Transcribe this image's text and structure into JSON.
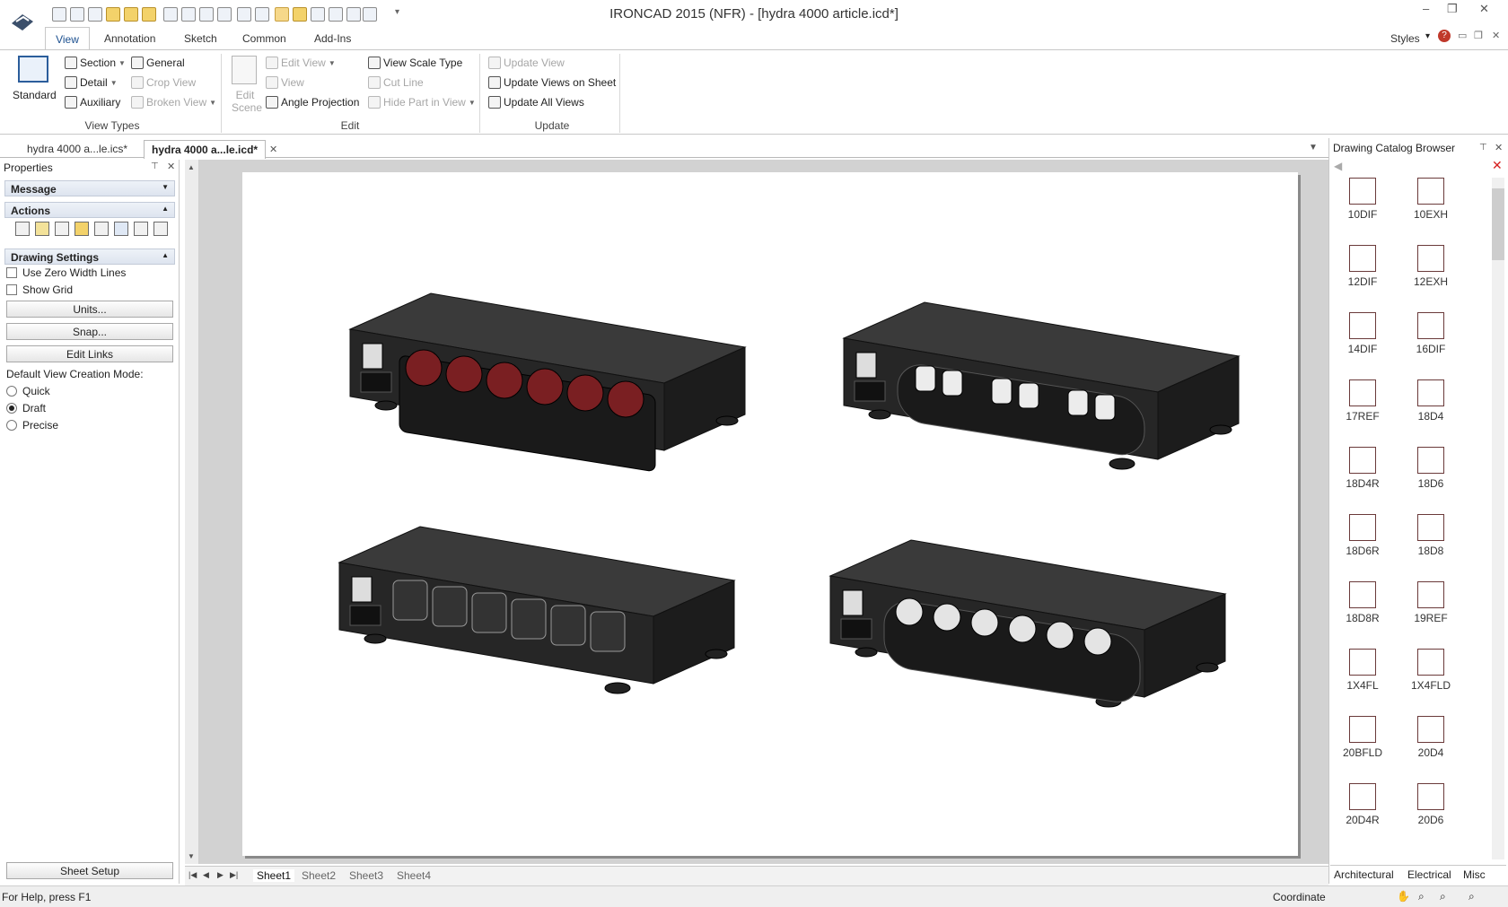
{
  "window": {
    "title": "IRONCAD 2015 (NFR) - [hydra 4000 article.icd*]",
    "styles_label": "Styles"
  },
  "ribbon_tabs": [
    "View",
    "Annotation",
    "Sketch",
    "Common",
    "Add-Ins"
  ],
  "ribbon": {
    "standard": "Standard",
    "section": "Section",
    "detail": "Detail",
    "auxiliary": "Auxiliary",
    "general": "General",
    "crop_view": "Crop View",
    "broken_view": "Broken View",
    "group_view_types": "View Types",
    "edit_scene": "Edit Scene",
    "edit_view": "Edit View",
    "view": "View",
    "angle_projection": "Angle Projection",
    "view_scale_type": "View Scale Type",
    "cut_line": "Cut Line",
    "hide_part_in_view": "Hide Part in View",
    "group_edit": "Edit",
    "update_view": "Update View",
    "update_views_on_sheet": "Update Views on Sheet",
    "update_all_views": "Update All Views",
    "group_update": "Update"
  },
  "doc_tabs": [
    "hydra 4000 a...le.ics*",
    "hydra 4000 a...le.icd*"
  ],
  "properties": {
    "title": "Properties",
    "message": "Message",
    "actions": "Actions",
    "drawing_settings": "Drawing Settings",
    "use_zero_width_lines": "Use Zero Width Lines",
    "show_grid": "Show Grid",
    "units_btn": "Units...",
    "snap_btn": "Snap...",
    "edit_links_btn": "Edit Links",
    "default_view_mode_label": "Default View Creation Mode:",
    "modes": [
      "Quick",
      "Draft",
      "Precise"
    ],
    "selected_mode": "Draft",
    "sheet_setup_btn": "Sheet Setup"
  },
  "sheet_tabs": [
    "Sheet1",
    "Sheet2",
    "Sheet3",
    "Sheet4"
  ],
  "catalog": {
    "title": "Drawing Catalog Browser",
    "items": [
      "10DIF",
      "10EXH",
      "12DIF",
      "12EXH",
      "14DIF",
      "16DIF",
      "17REF",
      "18D4",
      "18D4R",
      "18D6",
      "18D6R",
      "18D8",
      "18D8R",
      "19REF",
      "1X4FL",
      "1X4FLD",
      "20BFLD",
      "20D4",
      "20D4R",
      "20D6"
    ],
    "tabs": [
      "Architectural",
      "Electrical",
      "Misc"
    ]
  },
  "status": {
    "help": "For Help, press F1",
    "coordinate": "Coordinate"
  },
  "colors": {
    "accent": "#1b4f8f",
    "outlet_red": "#7a1f22",
    "device_body": "#2b2b2b"
  }
}
